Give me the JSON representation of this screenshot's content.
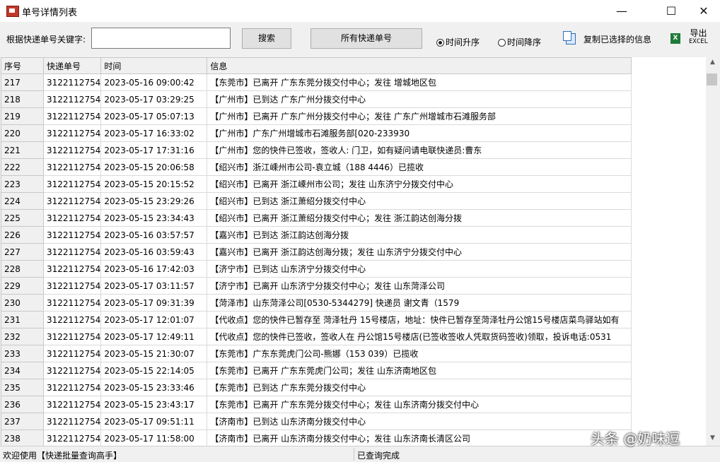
{
  "window": {
    "title": "单号详情列表",
    "minimize": "—",
    "maximize": "☐",
    "close": "✕"
  },
  "toolbar": {
    "keyword_label": "根据快递单号关键字:",
    "keyword_value": "",
    "search_button": "搜索",
    "all_button": "所有快递单号",
    "sort_asc": "时间升序",
    "sort_desc": "时间降序",
    "sort_selected": "asc",
    "copy_label": "复制已选择的信息",
    "export_label": "导出",
    "export_sub": "EXCEL"
  },
  "table": {
    "columns": [
      "序号",
      "快递单号",
      "时间",
      "信息"
    ],
    "rows": [
      [
        "217",
        "3122112754",
        "2023-05-16 09:00:42",
        "【东莞市】已离开 广东东莞分拨交付中心；发往 增城地区包"
      ],
      [
        "218",
        "3122112754",
        "2023-05-17 03:29:25",
        "【广州市】已到达 广东广州分拨交付中心"
      ],
      [
        "219",
        "3122112754",
        "2023-05-17 05:07:13",
        "【广州市】已离开 广东广州分拨交付中心；发往 广东广州增城市石滩服务部"
      ],
      [
        "220",
        "3122112754",
        "2023-05-17 16:33:02",
        "【广州市】广东广州增城市石滩服务部[020-233930"
      ],
      [
        "221",
        "3122112754",
        "2023-05-17 17:31:16",
        "【广州市】您的快件已签收，签收人: 门卫，如有疑问请电联快递员:曹东"
      ],
      [
        "222",
        "3122112754",
        "2023-05-15 20:06:58",
        "【绍兴市】浙江嵊州市公司-袁立城（188      4446）已揽收"
      ],
      [
        "223",
        "3122112754",
        "2023-05-15 20:15:52",
        "【绍兴市】已离开 浙江嵊州市公司；发往 山东济宁分拨交付中心"
      ],
      [
        "224",
        "3122112754",
        "2023-05-15 23:29:26",
        "【绍兴市】已到达 浙江萧绍分拨交付中心"
      ],
      [
        "225",
        "3122112754",
        "2023-05-15 23:34:43",
        "【绍兴市】已离开 浙江萧绍分拨交付中心；发往 浙江韵达创海分拨"
      ],
      [
        "226",
        "3122112754",
        "2023-05-16 03:57:57",
        "【嘉兴市】已到达 浙江韵达创海分拨"
      ],
      [
        "227",
        "3122112754",
        "2023-05-16 03:59:43",
        "【嘉兴市】已离开 浙江韵达创海分拨；发往 山东济宁分拨交付中心"
      ],
      [
        "228",
        "3122112754",
        "2023-05-16 17:42:03",
        "【济宁市】已到达 山东济宁分拨交付中心"
      ],
      [
        "229",
        "3122112754",
        "2023-05-17 03:11:57",
        "【济宁市】已离开 山东济宁分拨交付中心；发往 山东菏泽公司"
      ],
      [
        "230",
        "3122112754",
        "2023-05-17 09:31:39",
        "【菏泽市】山东菏泽公司[0530-5344279] 快递员 谢文青（1579"
      ],
      [
        "231",
        "3122112754",
        "2023-05-17 12:01:07",
        "【代收点】您的快件已暂存至 菏泽牡丹   15号楼店，地址：快件已暂存至菏泽牡丹公馆15号楼店菜鸟驿站如有"
      ],
      [
        "232",
        "3122112754",
        "2023-05-17 12:49:11",
        "【代收点】您的快件已签收，签收人在    丹公馆15号楼店(已签收签收人凭取货码签收)领取，投诉电话:0531"
      ],
      [
        "233",
        "3122112754",
        "2023-05-15 21:30:07",
        "【东莞市】广东东莞虎门公司-熊娜（153      039）已揽收"
      ],
      [
        "234",
        "3122112754",
        "2023-05-15 22:14:05",
        "【东莞市】已离开 广东东莞虎门公司；发往 山东济南地区包"
      ],
      [
        "235",
        "3122112754",
        "2023-05-15 23:33:46",
        "【东莞市】已到达 广东东莞分拨交付中心"
      ],
      [
        "236",
        "3122112754",
        "2023-05-15 23:43:17",
        "【东莞市】已离开 广东东莞分拨交付中心；发往 山东济南分拨交付中心"
      ],
      [
        "237",
        "3122112754",
        "2023-05-17 09:51:11",
        "【济南市】已到达 山东济南分拨交付中心"
      ],
      [
        "238",
        "3122112754",
        "2023-05-17 11:58:00",
        "【济南市】已离开 山东济南分拨交付中心；发往 山东济南长清区公司"
      ]
    ]
  },
  "status": {
    "left": "欢迎使用【快递批量查询高手】",
    "right": "已查询完成"
  },
  "watermark": "头条 @奶味逗"
}
